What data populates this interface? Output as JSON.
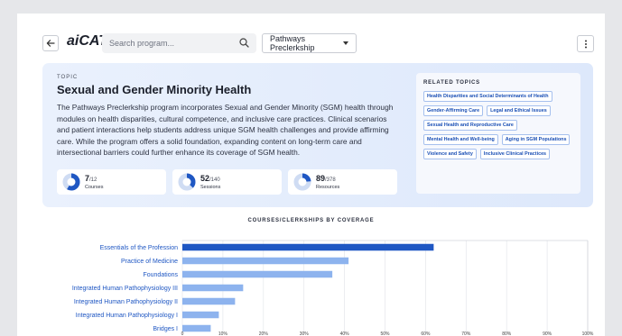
{
  "header": {
    "logo": "aiCAT",
    "search_placeholder": "Search program...",
    "program_select": "Pathways Preclerkship"
  },
  "topic": {
    "eyebrow": "TOPIC",
    "title": "Sexual and Gender Minority Health",
    "description": "The Pathways Preclerkship program incorporates Sexual and Gender Minority (SGM) health through modules on health disparities, cultural competence, and inclusive care practices. Clinical scenarios and patient interactions help students address unique SGM health challenges and provide affirming care. While the program offers a solid foundation, expanding content on long-term care and intersectional barriers could further enhance its coverage of SGM health."
  },
  "stats": [
    {
      "value": "7",
      "total": "/12",
      "label": "Courses",
      "fraction": 0.583
    },
    {
      "value": "52",
      "total": "/140",
      "label": "Sessions",
      "fraction": 0.371
    },
    {
      "value": "89",
      "total": "/378",
      "label": "Resources",
      "fraction": 0.235
    }
  ],
  "related": {
    "title": "RELATED TOPICS",
    "items": [
      "Health Disparities and Social Determinants of Health",
      "Gender-Affirming Care",
      "Legal and Ethical Issues",
      "Sexual Health and Reproductive Care",
      "Mental Health and Well-being",
      "Aging in SGM Populations",
      "Violence and Safety",
      "Inclusive Clinical Practices"
    ]
  },
  "colors": {
    "bar_primary": "#1f57c3",
    "bar_secondary": "#8db3ee",
    "label": "#1f57c3",
    "donut_fill": "#1f57c3",
    "donut_track": "#cfdcf3"
  },
  "chart_data": {
    "type": "bar",
    "orientation": "horizontal",
    "title": "COURSES/CLERKSHIPS BY COVERAGE",
    "categories": [
      "Essentials of the Profession",
      "Practice of Medicine",
      "Foundations",
      "Integrated Human Pathophysiology III",
      "Integrated Human Pathophysiology II",
      "Integrated Human Pathophysiology I",
      "Bridges I"
    ],
    "values": [
      62,
      41,
      37,
      15,
      13,
      9,
      7
    ],
    "xlim": [
      0,
      100
    ],
    "x_ticks": [
      "0",
      "10%",
      "20%",
      "30%",
      "40%",
      "50%",
      "60%",
      "70%",
      "80%",
      "90%",
      "100%"
    ],
    "grid": true
  }
}
